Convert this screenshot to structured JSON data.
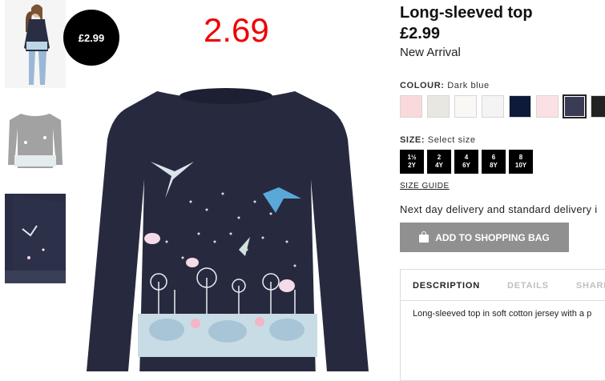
{
  "badge_price": "£2.99",
  "overlay_price": "2.69",
  "product": {
    "title": "Long-sleeved top",
    "price": "£2.99",
    "tag": "New Arrival"
  },
  "colour": {
    "label": "COLOUR:",
    "selected": "Dark blue",
    "swatches": [
      "#f9d9d9",
      "#e9e7e2",
      "#faf8f4",
      "#f4f4f4",
      "#0d1a3a",
      "#fbe1e4",
      "#3a3c56",
      "#222222"
    ]
  },
  "size": {
    "label": "SIZE:",
    "prompt": "Select size",
    "options": [
      {
        "top": "1½",
        "bottom": "2Y"
      },
      {
        "top": "2",
        "bottom": "4Y"
      },
      {
        "top": "4",
        "bottom": "6Y"
      },
      {
        "top": "6",
        "bottom": "8Y"
      },
      {
        "top": "8",
        "bottom": "10Y"
      }
    ]
  },
  "size_guide": "SIZE GUIDE",
  "delivery": "Next day delivery and standard delivery i",
  "add_to_bag": "ADD TO SHOPPING BAG",
  "tabs": [
    "DESCRIPTION",
    "DETAILS",
    "SHARE"
  ],
  "description": "Long-sleeved top in soft cotton jersey with a p"
}
